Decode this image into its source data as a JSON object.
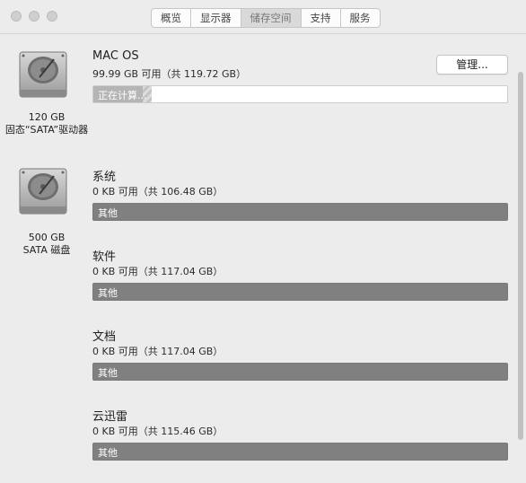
{
  "toolbar": {
    "tabs": [
      {
        "label": "概览"
      },
      {
        "label": "显示器"
      },
      {
        "label": "储存空间"
      },
      {
        "label": "支持"
      },
      {
        "label": "服务"
      }
    ]
  },
  "disks": [
    {
      "size": "120 GB",
      "name": "固态“SATA”驱动器"
    },
    {
      "size": "500 GB",
      "name": "SATA 磁盘"
    }
  ],
  "volumes": {
    "mac": {
      "name": "MAC OS",
      "capacity": "99.99 GB 可用（共 119.72 GB）",
      "bar_label": "正在计算...",
      "progress_fraction": 0.12,
      "manage_label": "管理..."
    },
    "v1": {
      "name": "系统",
      "capacity": "0 KB 可用（共 106.48 GB）",
      "bar_label": "其他"
    },
    "v2": {
      "name": "软件",
      "capacity": "0 KB 可用（共 117.04 GB）",
      "bar_label": "其他"
    },
    "v3": {
      "name": "文档",
      "capacity": "0 KB 可用（共 117.04 GB）",
      "bar_label": "其他"
    },
    "v4": {
      "name": "云迅雷",
      "capacity": "0 KB 可用（共 115.46 GB）",
      "bar_label": "其他"
    }
  },
  "colors": {
    "window_bg": "#ececec",
    "bar_other": "#808080",
    "bar_empty": "#ffffff"
  }
}
